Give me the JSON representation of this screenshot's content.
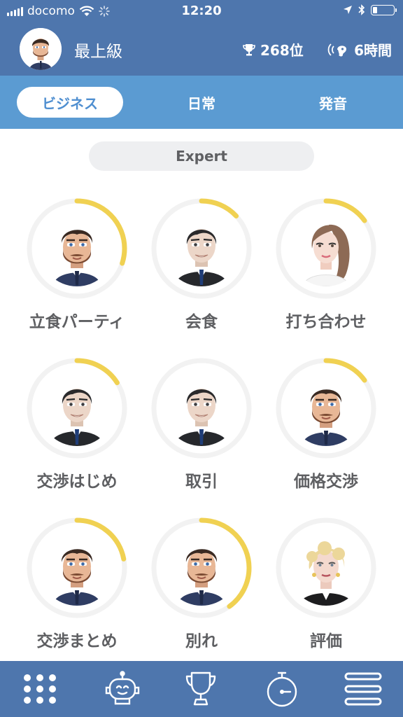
{
  "status_bar": {
    "carrier": "docomo",
    "time": "12:20",
    "icons": [
      "signal-icon",
      "wifi-icon",
      "loading-icon",
      "location-icon",
      "bluetooth-icon",
      "battery-icon"
    ]
  },
  "header": {
    "level": "最上級",
    "rank": "268位",
    "study_time": "6時間",
    "icons": [
      "trophy-icon",
      "listening-icon"
    ]
  },
  "tabs": [
    {
      "label": "ビジネス",
      "active": true
    },
    {
      "label": "日常",
      "active": false
    },
    {
      "label": "発音",
      "active": false
    }
  ],
  "level_selector": {
    "label": "Expert"
  },
  "scenarios": [
    {
      "label": "立食パーティ",
      "progress": 0.3,
      "character": "bearded-man"
    },
    {
      "label": "会食",
      "progress": 0.13,
      "character": "clean-shaven-man"
    },
    {
      "label": "打ち合わせ",
      "progress": 0.15,
      "character": "woman-brunette"
    },
    {
      "label": "交渉はじめ",
      "progress": 0.16,
      "character": "clean-shaven-man"
    },
    {
      "label": "取引",
      "progress": 0.0,
      "character": "clean-shaven-man"
    },
    {
      "label": "価格交渉",
      "progress": 0.15,
      "character": "bearded-man"
    },
    {
      "label": "交渉まとめ",
      "progress": 0.22,
      "character": "bearded-man"
    },
    {
      "label": "別れ",
      "progress": 0.4,
      "character": "bearded-man"
    },
    {
      "label": "評価",
      "progress": 0.0,
      "character": "woman-blonde"
    }
  ],
  "bottom_nav": [
    "grid-icon",
    "robot-icon",
    "trophy-icon",
    "stopwatch-icon",
    "menu-icon"
  ],
  "colors": {
    "primary": "#4e76ad",
    "tab_bar": "#5b9bd2",
    "progress": "#f0d152",
    "ring_track": "#f2f2f2",
    "label": "#5e5f62"
  }
}
